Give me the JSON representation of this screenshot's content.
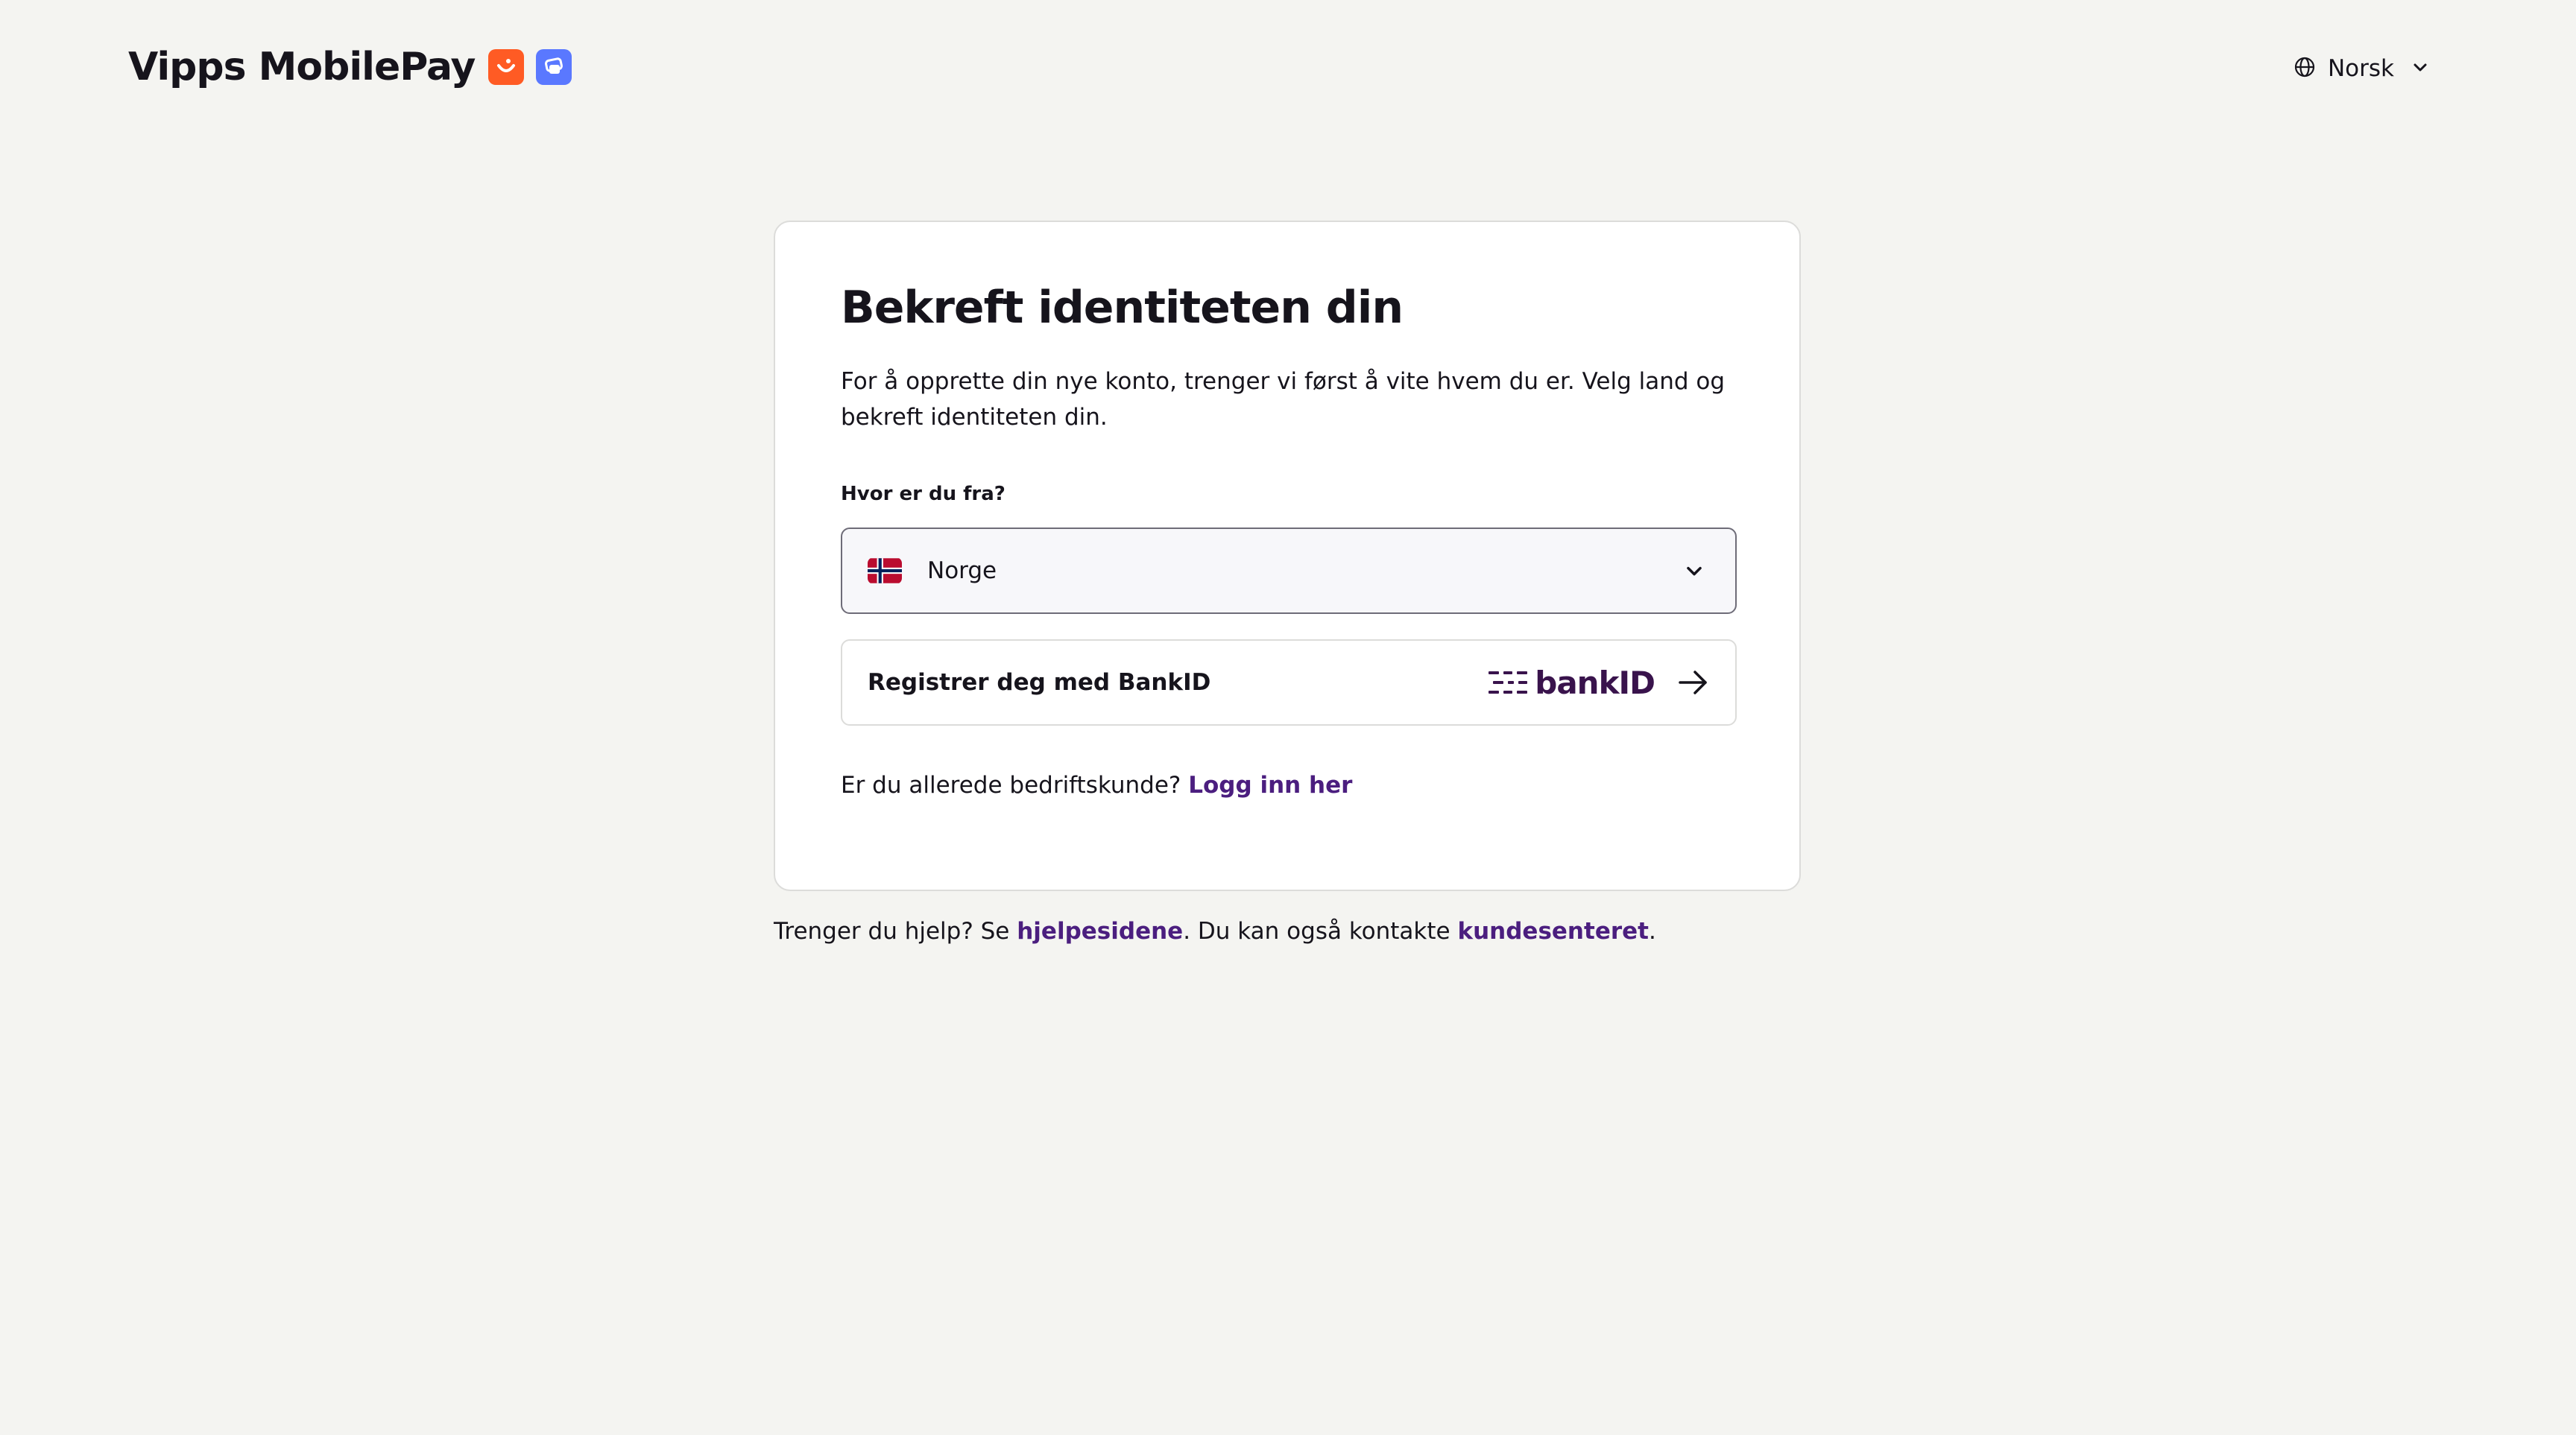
{
  "header": {
    "brand": "Vipps MobilePay",
    "language": "Norsk"
  },
  "card": {
    "title": "Bekreft identiteten din",
    "intro": "For å opprette din nye konto, trenger vi først å vite hvem du er. Velg land og bekreft identiteten din.",
    "country_label": "Hvor er du fra?",
    "country_value": "Norge",
    "bankid_button_label": "Registrer deg med BankID",
    "bankid_logo_text": "bankID",
    "business_prompt": "Er du allerede bedriftskunde?",
    "business_link": "Logg inn her"
  },
  "help": {
    "prefix": "Trenger du hjelp? Se",
    "help_pages_link": "hjelpesidene",
    "middle": ". Du kan også kontakte",
    "customer_center_link": "kundesenteret",
    "suffix": "."
  },
  "colors": {
    "background": "#f4f4f1",
    "vipps_orange": "#ff5b24",
    "mobilepay_blue": "#5a78ff",
    "link_purple": "#4b1e7f",
    "bankid_purple": "#39134c"
  },
  "icons": {
    "language": "globe-icon",
    "language_dropdown": "chevron-down-icon",
    "country_flag": "norway-flag-icon",
    "country_dropdown": "chevron-down-icon",
    "bankid_arrow": "arrow-right-icon"
  }
}
